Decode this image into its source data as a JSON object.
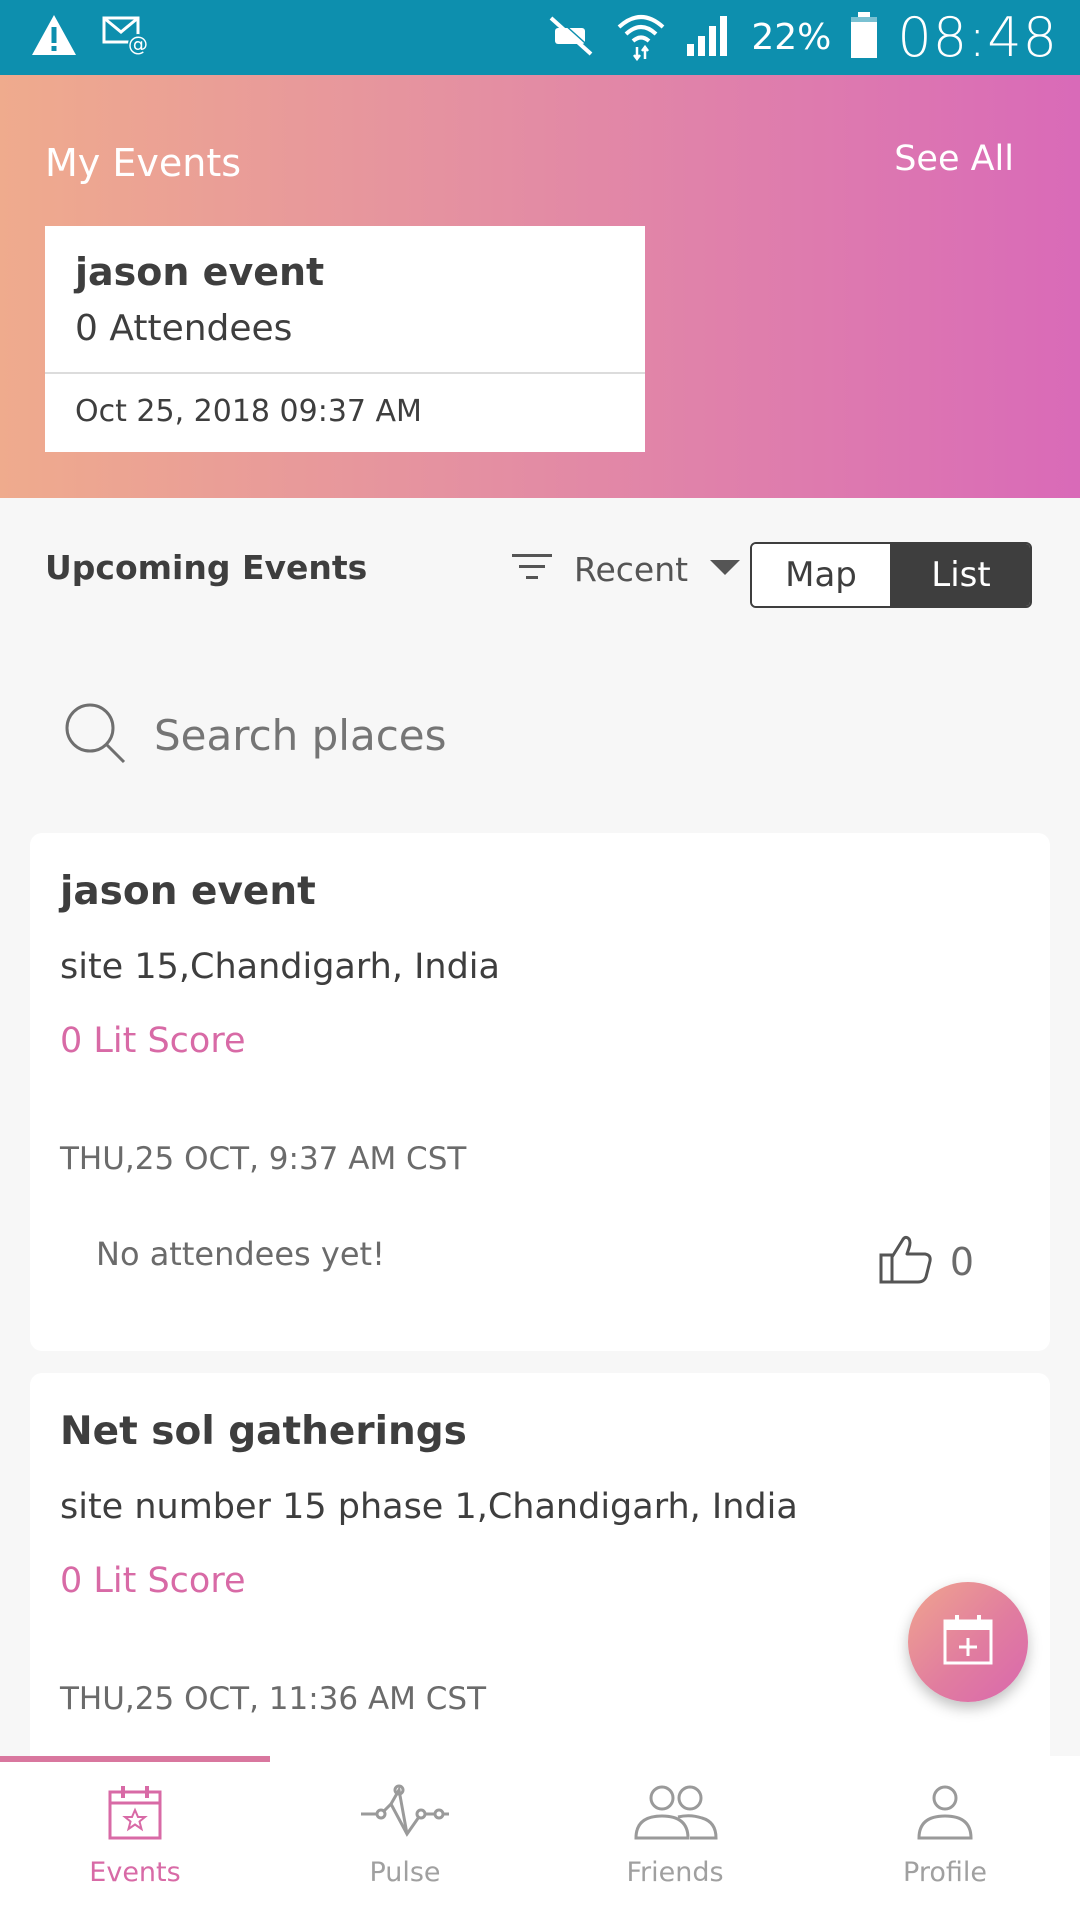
{
  "status_bar": {
    "battery": "22%",
    "time": "08:48",
    "icons": [
      "warning-icon",
      "mail-at-icon",
      "mute-icon",
      "wifi-icon",
      "signal-icon",
      "battery-icon"
    ]
  },
  "my_events": {
    "title": "My Events",
    "see_all": "See All",
    "card": {
      "name": "jason event",
      "attendees": "0 Attendees",
      "date": "Oct 25, 2018 09:37 AM"
    }
  },
  "upcoming": {
    "title": "Upcoming Events",
    "sort": "Recent",
    "toggle": {
      "map": "Map",
      "list": "List",
      "selected": "List"
    }
  },
  "search": {
    "placeholder": "Search places"
  },
  "events": [
    {
      "name": "jason event",
      "location": "site 15,Chandigarh,  India",
      "score": "0 Lit Score",
      "datetime": "THU,25 OCT, 9:37 AM CST",
      "attendees": "No attendees yet!",
      "likes": "0"
    },
    {
      "name": "Net sol gatherings",
      "location": "site number 15 phase 1,Chandigarh,  India",
      "score": "0 Lit Score",
      "datetime": "THU,25 OCT, 11:36 AM CST"
    }
  ],
  "bottom_nav": {
    "items": [
      {
        "label": "Events",
        "icon": "calendar-star-icon",
        "active": true
      },
      {
        "label": "Pulse",
        "icon": "pulse-icon",
        "active": false
      },
      {
        "label": "Friends",
        "icon": "friends-icon",
        "active": false
      },
      {
        "label": "Profile",
        "icon": "profile-icon",
        "active": false
      }
    ]
  },
  "colors": {
    "status_bar": "#0d8fae",
    "accent_pink": "#d86aa6",
    "gradient_start": "#efab8d",
    "gradient_end": "#d96ab8",
    "dark": "#3e3e3e"
  }
}
